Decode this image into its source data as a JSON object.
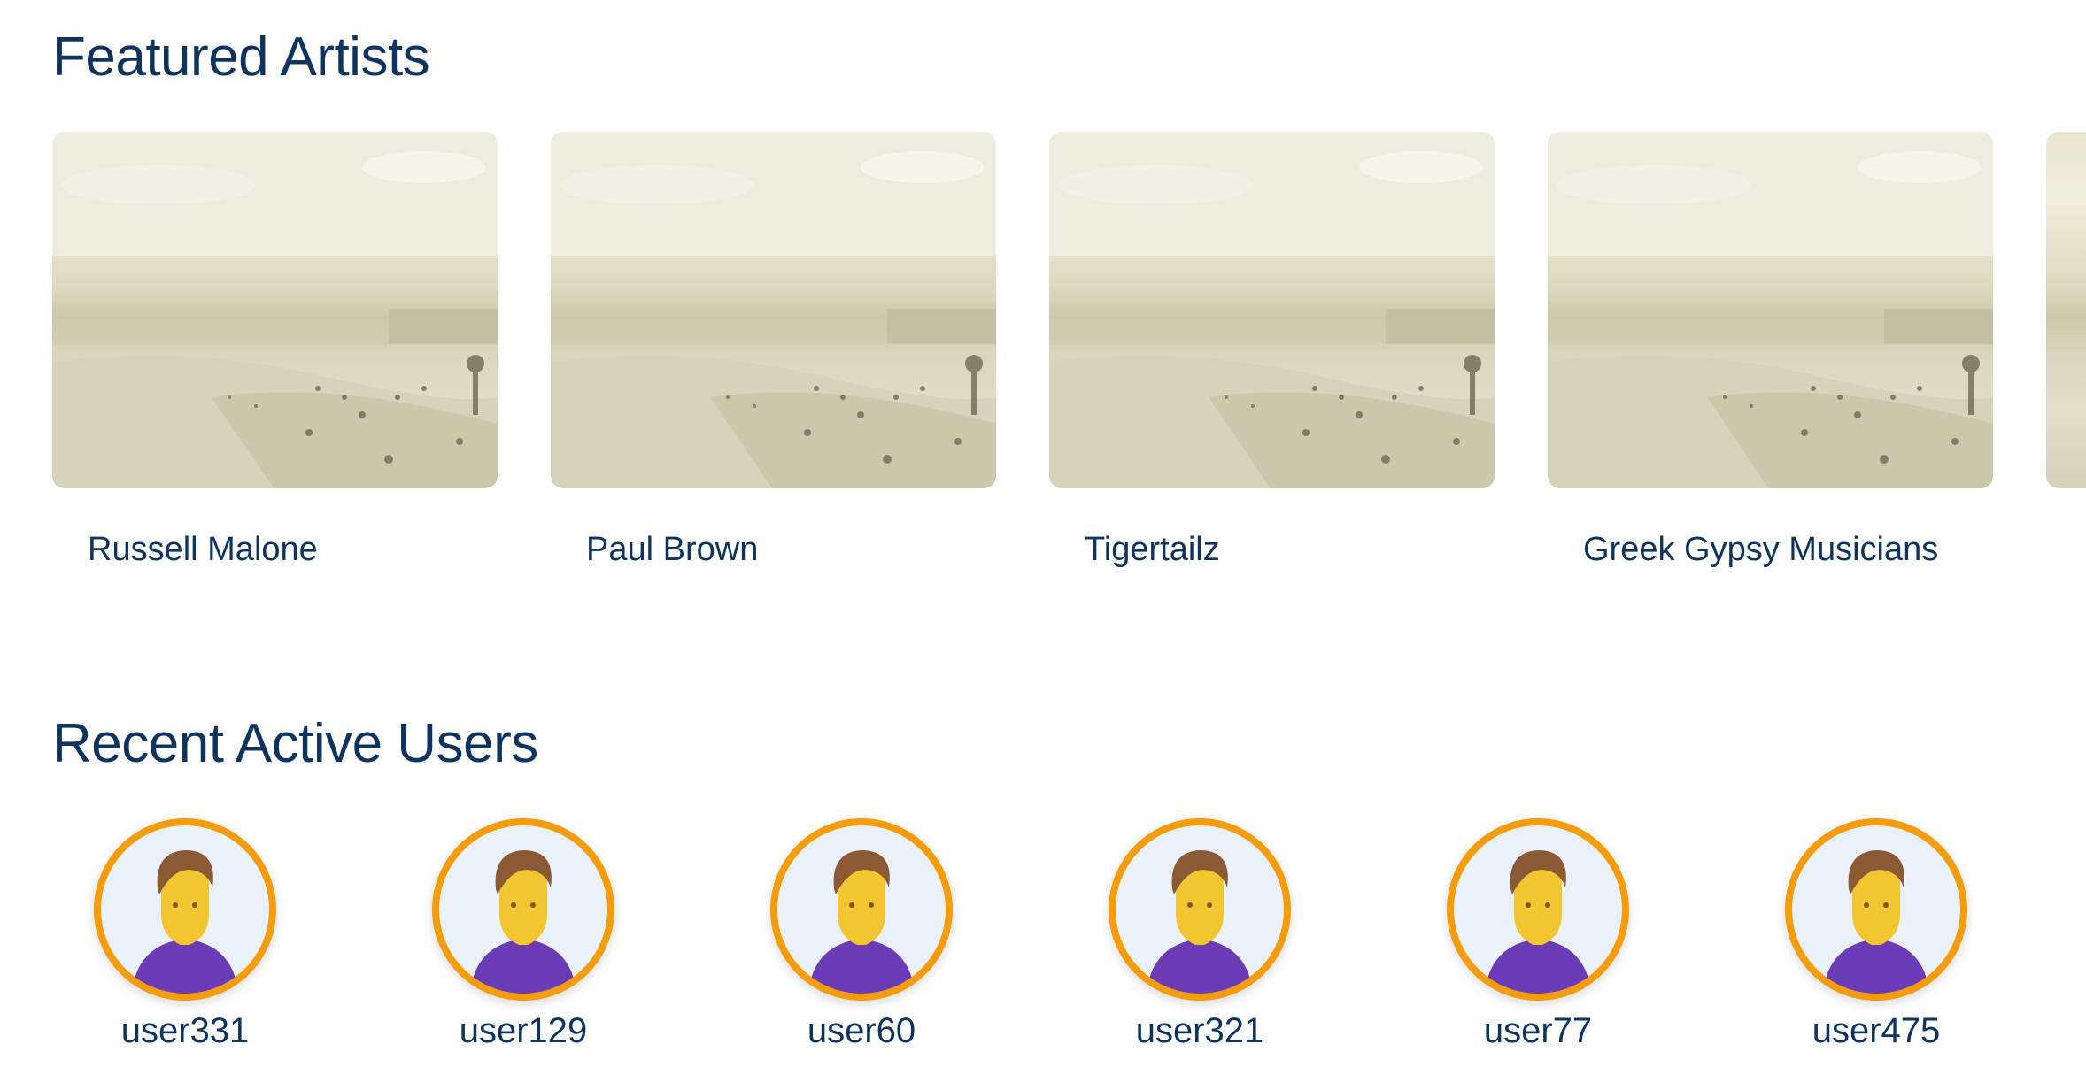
{
  "featured": {
    "title": "Featured Artists",
    "artists": [
      {
        "name": "Russell Malone"
      },
      {
        "name": "Paul Brown"
      },
      {
        "name": "Tigertailz"
      },
      {
        "name": "Greek Gypsy Musicians"
      }
    ]
  },
  "users": {
    "title": "Recent Active Users",
    "items": [
      {
        "name": "user331"
      },
      {
        "name": "user129"
      },
      {
        "name": "user60"
      },
      {
        "name": "user321"
      },
      {
        "name": "user77"
      },
      {
        "name": "user475"
      }
    ]
  },
  "colors": {
    "heading": "#0d3461",
    "avatar_ring": "#f59c0b",
    "avatar_bg": "#eaf1f8",
    "avatar_shirt": "#6a3bb5",
    "avatar_skin": "#f2c531",
    "avatar_hair": "#8a5a34"
  }
}
